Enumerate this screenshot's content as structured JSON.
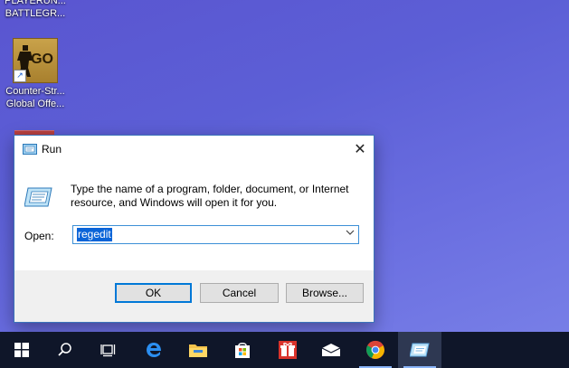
{
  "desktop": {
    "icons": [
      {
        "label_line1": "PLAYERUN...",
        "label_line2": "BATTLEGR..."
      },
      {
        "label_line1": "Counter-Str...",
        "label_line2": "Global Offe...",
        "badge": "GO"
      }
    ]
  },
  "run_dialog": {
    "title": "Run",
    "close_glyph": "✕",
    "description": "Type the name of a program, folder, document, or Internet resource, and Windows will open it for you.",
    "open_label": "Open:",
    "open_value": "regedit",
    "ok_label": "OK",
    "cancel_label": "Cancel",
    "browse_label": "Browse..."
  },
  "taskbar": {
    "items": [
      {
        "name": "start-button",
        "icon": "windows-logo-icon"
      },
      {
        "name": "search-button",
        "icon": "search-icon"
      },
      {
        "name": "task-view-button",
        "icon": "task-view-icon"
      },
      {
        "name": "edge-button",
        "icon": "edge-icon"
      },
      {
        "name": "file-explorer-button",
        "icon": "folder-icon"
      },
      {
        "name": "store-button",
        "icon": "store-bag-icon"
      },
      {
        "name": "gift-app-button",
        "icon": "gift-icon"
      },
      {
        "name": "mail-button",
        "icon": "mail-icon"
      },
      {
        "name": "chrome-button",
        "icon": "chrome-icon"
      },
      {
        "name": "run-taskbar-button",
        "icon": "run-icon"
      }
    ]
  },
  "colors": {
    "accent": "#0078d7",
    "selection": "#0a64d8",
    "taskbar": "#0f1629"
  }
}
